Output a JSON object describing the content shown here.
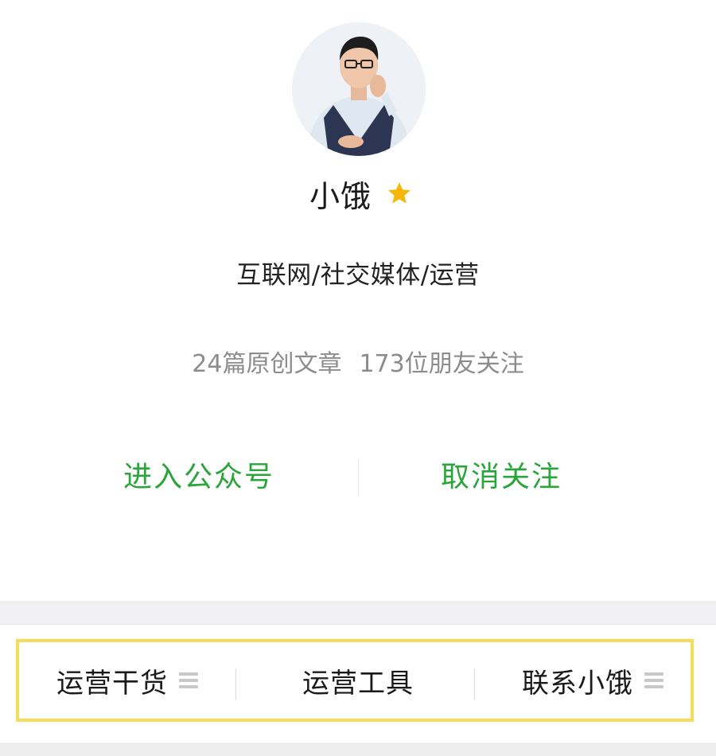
{
  "profile": {
    "name": "小饿",
    "verified_icon": "star-icon",
    "category": "互联网/社交媒体/运营",
    "stats": {
      "articles": "24篇原创文章",
      "followers": "173位朋友关注"
    }
  },
  "actions": {
    "enter_label": "进入公众号",
    "unfollow_label": "取消关注"
  },
  "menu": {
    "items": [
      {
        "label": "运营干货",
        "has_submenu": true
      },
      {
        "label": "运营工具",
        "has_submenu": false
      },
      {
        "label": "联系小饿",
        "has_submenu": true
      }
    ]
  },
  "colors": {
    "accent_green": "#2aa53b",
    "star_gold": "#f5b80a",
    "highlight_yellow": "#f5dc5a",
    "text_primary": "#1a1a1a",
    "text_secondary": "#8c8c8c"
  }
}
